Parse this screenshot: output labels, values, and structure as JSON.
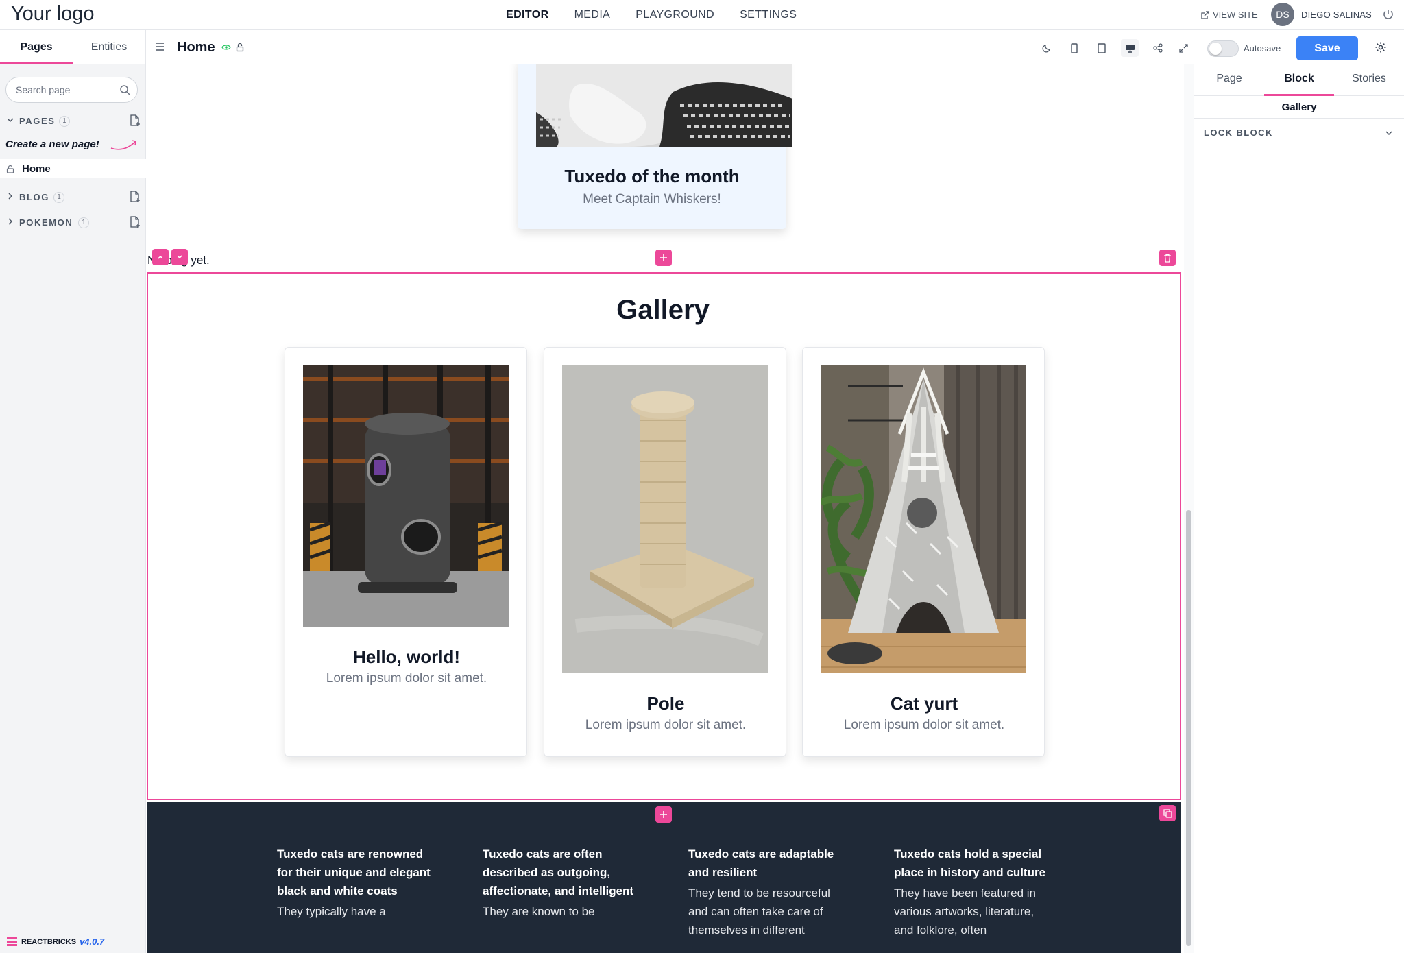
{
  "topnav": {
    "logo": "Your logo",
    "items": [
      "EDITOR",
      "MEDIA",
      "PLAYGROUND",
      "SETTINGS"
    ],
    "view_site": "VIEW SITE",
    "avatar_initials": "DS",
    "user_name": "DIEGO SALINAS"
  },
  "sidebar": {
    "tabs": [
      "Pages",
      "Entities"
    ],
    "search_placeholder": "Search page",
    "sections": [
      {
        "label": "PAGES",
        "count": "1"
      },
      {
        "label": "BLOG",
        "count": "1"
      },
      {
        "label": "POKEMON",
        "count": "1"
      }
    ],
    "create_hint": "Create a new page!",
    "home_item": "Home"
  },
  "toolbar": {
    "page_title": "Home",
    "autosave_label": "Autosave",
    "save_label": "Save"
  },
  "rightpanel": {
    "tabs": [
      "Page",
      "Block",
      "Stories"
    ],
    "block_name": "Gallery",
    "lock_block": "LOCK BLOCK"
  },
  "canvas": {
    "feature_card": {
      "title": "Tuxedo of the month",
      "subtitle": "Meet Captain Whiskers!"
    },
    "no_blog_text": "No blog yet.",
    "gallery": {
      "title": "Gallery",
      "cards": [
        {
          "title": "Hello, world!",
          "subtitle": "Lorem ipsum dolor sit amet."
        },
        {
          "title": "Pole",
          "subtitle": "Lorem ipsum dolor sit amet."
        },
        {
          "title": "Cat yurt",
          "subtitle": "Lorem ipsum dolor sit amet."
        }
      ]
    },
    "features": [
      {
        "heading": "Tuxedo cats are renowned for their unique and elegant black and white coats",
        "text": "They typically have a"
      },
      {
        "heading": "Tuxedo cats are often described as outgoing, affectionate, and intelligent",
        "text": "They are known to be"
      },
      {
        "heading": "Tuxedo cats are adaptable and resilient",
        "text": "They tend to be resourceful and can often take care of themselves in different"
      },
      {
        "heading": "Tuxedo cats hold a special place in history and culture",
        "text": "They have been featured in various artworks, literature, and folklore, often"
      }
    ]
  },
  "footer_badge": {
    "brand": "REACTBRICKS",
    "version": "v4.0.7"
  },
  "colors": {
    "accent": "#ec4899",
    "primary": "#3b82f6",
    "dark_block": "#1f2937"
  }
}
